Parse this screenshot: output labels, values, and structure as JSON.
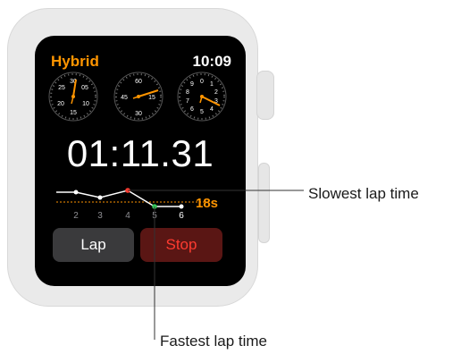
{
  "watch": {
    "mode_label": "Hybrid",
    "time": "10:09",
    "elapsed": "01:11.31",
    "lap_button": "Lap",
    "stop_button": "Stop",
    "target_label": "18s",
    "lap_numbers": [
      "2",
      "3",
      "4",
      "5",
      "6"
    ],
    "dial_left_numbers": [
      "30",
      "25",
      "05",
      "20",
      "10",
      "15"
    ],
    "dial_mid_numbers": [
      "60",
      "45",
      "15",
      "30"
    ],
    "dial_right_numbers": [
      "9",
      "0",
      "1",
      "8",
      "2",
      "7",
      "3",
      "6",
      "5",
      "4"
    ],
    "colors": {
      "accent": "#ff9500",
      "slowest": "#ff3b30",
      "fastest": "#34c759",
      "stop_bg": "#5a1614",
      "lap_bg": "#3a3a3c"
    }
  },
  "callouts": {
    "slowest": "Slowest lap time",
    "fastest": "Fastest lap time"
  }
}
